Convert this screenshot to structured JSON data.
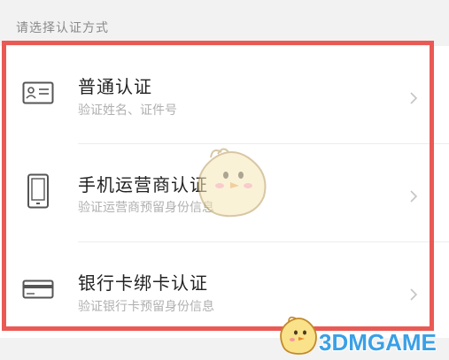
{
  "section_title": "请选择认证方式",
  "options": [
    {
      "title": "普通认证",
      "subtitle": "验证姓名、证件号",
      "icon": "id-card-icon"
    },
    {
      "title": "手机运营商认证",
      "subtitle": "验证运营商预留身份信息",
      "icon": "phone-icon"
    },
    {
      "title": "银行卡绑卡认证",
      "subtitle": "验证银行卡预留身份信息",
      "icon": "bank-card-icon"
    }
  ],
  "watermark": {
    "text": "3DMGAME"
  },
  "colors": {
    "highlight_border": "#ea5a55",
    "title_text": "#222222",
    "subtitle_text": "#b0b0b0",
    "watermark_text": "#3aa0e6"
  }
}
